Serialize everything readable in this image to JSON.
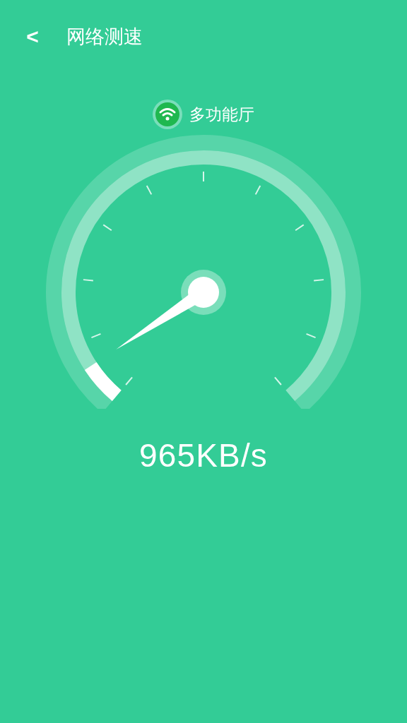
{
  "header": {
    "back": "<",
    "title": "网络测速"
  },
  "network": {
    "name": "多功能厅"
  },
  "gauge": {
    "level": 0.06
  },
  "speed": "965KB/s"
}
